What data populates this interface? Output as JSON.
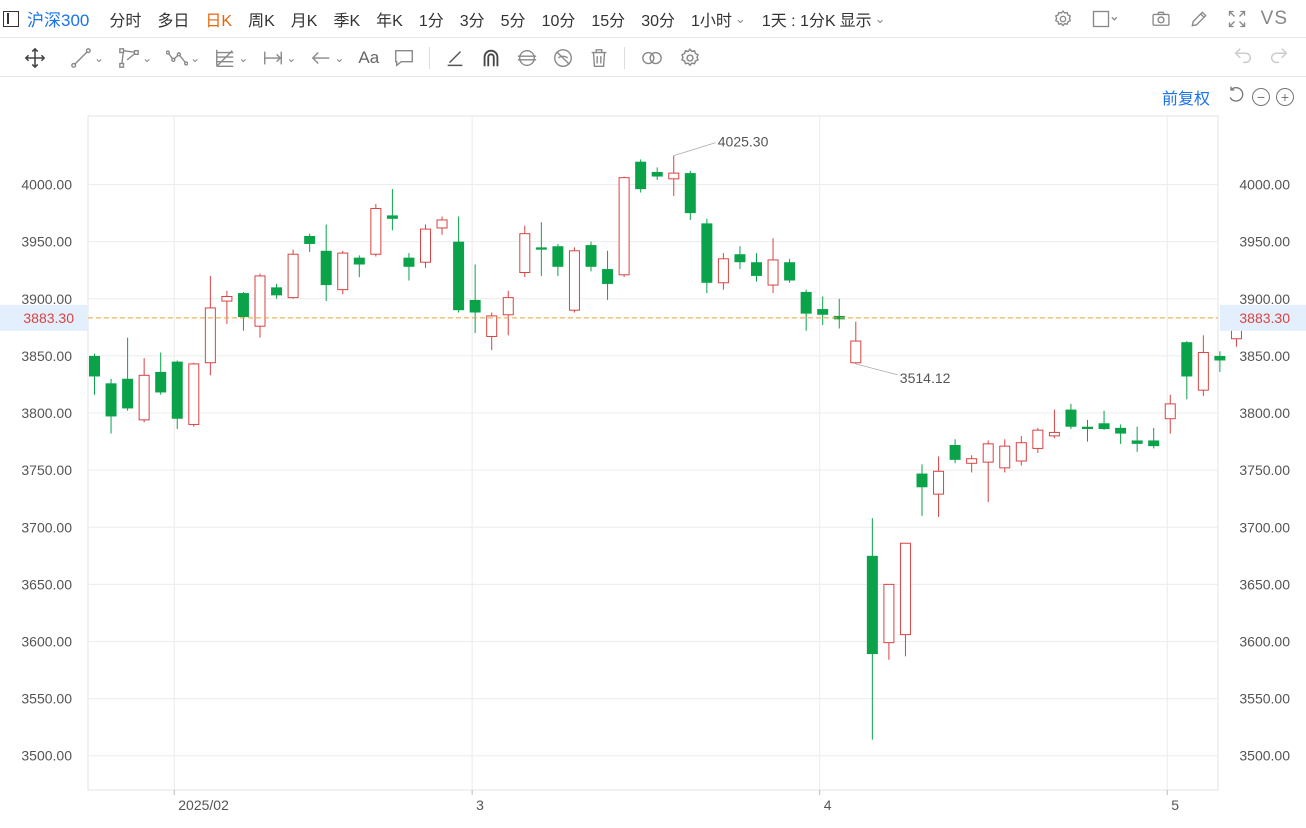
{
  "toolbar": {
    "symbol": "沪深300",
    "periods": [
      "分时",
      "多日",
      "日K",
      "周K",
      "月K",
      "季K",
      "年K",
      "1分",
      "3分",
      "5分",
      "10分",
      "15分",
      "30分"
    ],
    "active_period": "日K",
    "hour_dropdown": "1小时",
    "range_dropdown": "1天 : 1分K",
    "display_dropdown": "显示",
    "vs_label": "VS"
  },
  "drawing_tools": [
    "move",
    "line",
    "polyline",
    "wave",
    "fib",
    "measure",
    "arrow",
    "text",
    "note",
    "brush",
    "arc",
    "magnet",
    "hide",
    "delete",
    "compare",
    "settings"
  ],
  "chart_controls": {
    "adjust_label": "前复权"
  },
  "chart_data": {
    "type": "candlestick",
    "ylim": [
      3470,
      4060
    ],
    "yticks": [
      "3500.00",
      "3550.00",
      "3600.00",
      "3650.00",
      "3700.00",
      "3750.00",
      "3800.00",
      "3850.00",
      "3900.00",
      "3950.00",
      "4000.00"
    ],
    "xticks": [
      {
        "label": "2025/02",
        "index": 5
      },
      {
        "label": "3",
        "index": 23
      },
      {
        "label": "4",
        "index": 44
      },
      {
        "label": "5",
        "index": 65
      }
    ],
    "current_price": "3883.30",
    "current_value": 3883.3,
    "max_label": "4025.30",
    "max_index": 35,
    "min_label": "3514.12",
    "min_index": 46,
    "up_color": "#d94343",
    "down_color": "#0aa34a",
    "candles": [
      {
        "o": 3850,
        "h": 3852,
        "l": 3816,
        "c": 3832
      },
      {
        "o": 3826,
        "h": 3830,
        "l": 3782,
        "c": 3797
      },
      {
        "o": 3830,
        "h": 3866,
        "l": 3802,
        "c": 3804
      },
      {
        "o": 3794,
        "h": 3848,
        "l": 3792,
        "c": 3833
      },
      {
        "o": 3836,
        "h": 3853,
        "l": 3816,
        "c": 3818
      },
      {
        "o": 3845,
        "h": 3846,
        "l": 3786,
        "c": 3795
      },
      {
        "o": 3790,
        "h": 3844,
        "l": 3788,
        "c": 3843
      },
      {
        "o": 3844,
        "h": 3920,
        "l": 3833,
        "c": 3892
      },
      {
        "o": 3898,
        "h": 3907,
        "l": 3878,
        "c": 3902
      },
      {
        "o": 3905,
        "h": 3906,
        "l": 3872,
        "c": 3884
      },
      {
        "o": 3876,
        "h": 3922,
        "l": 3866,
        "c": 3920
      },
      {
        "o": 3910,
        "h": 3913,
        "l": 3900,
        "c": 3903
      },
      {
        "o": 3901,
        "h": 3943,
        "l": 3900,
        "c": 3939
      },
      {
        "o": 3955,
        "h": 3957,
        "l": 3941,
        "c": 3948
      },
      {
        "o": 3942,
        "h": 3965,
        "l": 3898,
        "c": 3912
      },
      {
        "o": 3908,
        "h": 3942,
        "l": 3904,
        "c": 3940
      },
      {
        "o": 3936,
        "h": 3938,
        "l": 3919,
        "c": 3930
      },
      {
        "o": 3939,
        "h": 3983,
        "l": 3937,
        "c": 3979
      },
      {
        "o": 3973,
        "h": 3996,
        "l": 3960,
        "c": 3970
      },
      {
        "o": 3936,
        "h": 3940,
        "l": 3916,
        "c": 3928
      },
      {
        "o": 3932,
        "h": 3965,
        "l": 3927,
        "c": 3961
      },
      {
        "o": 3962,
        "h": 3972,
        "l": 3956,
        "c": 3969
      },
      {
        "o": 3950,
        "h": 3972,
        "l": 3888,
        "c": 3890
      },
      {
        "o": 3899,
        "h": 3930,
        "l": 3870,
        "c": 3888
      },
      {
        "o": 3867,
        "h": 3888,
        "l": 3855,
        "c": 3885
      },
      {
        "o": 3886,
        "h": 3907,
        "l": 3868,
        "c": 3901
      },
      {
        "o": 3923,
        "h": 3964,
        "l": 3919,
        "c": 3957
      },
      {
        "o": 3945,
        "h": 3967,
        "l": 3920,
        "c": 3943
      },
      {
        "o": 3946,
        "h": 3948,
        "l": 3920,
        "c": 3928
      },
      {
        "o": 3890,
        "h": 3945,
        "l": 3888,
        "c": 3942
      },
      {
        "o": 3947,
        "h": 3950,
        "l": 3924,
        "c": 3928
      },
      {
        "o": 3926,
        "h": 3942,
        "l": 3899,
        "c": 3913
      },
      {
        "o": 3921,
        "h": 4007,
        "l": 3919,
        "c": 4006
      },
      {
        "o": 4020,
        "h": 4022,
        "l": 3993,
        "c": 3996
      },
      {
        "o": 4011,
        "h": 4015,
        "l": 4004,
        "c": 4007
      },
      {
        "o": 4005,
        "h": 4025.3,
        "l": 3990,
        "c": 4010
      },
      {
        "o": 4010,
        "h": 4012,
        "l": 3969,
        "c": 3975
      },
      {
        "o": 3966,
        "h": 3970,
        "l": 3905,
        "c": 3914
      },
      {
        "o": 3914,
        "h": 3940,
        "l": 3908,
        "c": 3935
      },
      {
        "o": 3939,
        "h": 3946,
        "l": 3926,
        "c": 3932
      },
      {
        "o": 3932,
        "h": 3940,
        "l": 3915,
        "c": 3920
      },
      {
        "o": 3912,
        "h": 3953,
        "l": 3905,
        "c": 3934
      },
      {
        "o": 3932,
        "h": 3935,
        "l": 3914,
        "c": 3916
      },
      {
        "o": 3906,
        "h": 3908,
        "l": 3872,
        "c": 3887
      },
      {
        "o": 3891,
        "h": 3902,
        "l": 3877,
        "c": 3886
      },
      {
        "o": 3885,
        "h": 3900,
        "l": 3874,
        "c": 3882
      },
      {
        "o": 3844,
        "h": 3880,
        "l": 3843,
        "c": 3863
      },
      {
        "o": 3675,
        "h": 3708,
        "l": 3514.12,
        "c": 3589
      },
      {
        "o": 3599,
        "h": 3650,
        "l": 3584,
        "c": 3650
      },
      {
        "o": 3606,
        "h": 3686,
        "l": 3587,
        "c": 3686
      },
      {
        "o": 3747,
        "h": 3755,
        "l": 3710,
        "c": 3735
      },
      {
        "o": 3729,
        "h": 3762,
        "l": 3709,
        "c": 3749
      },
      {
        "o": 3772,
        "h": 3777,
        "l": 3756,
        "c": 3759
      },
      {
        "o": 3756,
        "h": 3763,
        "l": 3748,
        "c": 3760
      },
      {
        "o": 3757,
        "h": 3776,
        "l": 3722,
        "c": 3773
      },
      {
        "o": 3752,
        "h": 3777,
        "l": 3748,
        "c": 3771
      },
      {
        "o": 3758,
        "h": 3780,
        "l": 3754,
        "c": 3774
      },
      {
        "o": 3769,
        "h": 3787,
        "l": 3765,
        "c": 3785
      },
      {
        "o": 3780,
        "h": 3803,
        "l": 3778,
        "c": 3783
      },
      {
        "o": 3803,
        "h": 3808,
        "l": 3786,
        "c": 3788
      },
      {
        "o": 3788,
        "h": 3794,
        "l": 3775,
        "c": 3786
      },
      {
        "o": 3791,
        "h": 3802,
        "l": 3785,
        "c": 3786
      },
      {
        "o": 3787,
        "h": 3790,
        "l": 3773,
        "c": 3782
      },
      {
        "o": 3776,
        "h": 3788,
        "l": 3766,
        "c": 3773
      },
      {
        "o": 3776,
        "h": 3787,
        "l": 3769,
        "c": 3771
      },
      {
        "o": 3795,
        "h": 3816,
        "l": 3782,
        "c": 3808
      },
      {
        "o": 3862,
        "h": 3863,
        "l": 3812,
        "c": 3832
      },
      {
        "o": 3820,
        "h": 3868,
        "l": 3815,
        "c": 3853
      },
      {
        "o": 3850,
        "h": 3854,
        "l": 3836,
        "c": 3846
      },
      {
        "o": 3865,
        "h": 3891,
        "l": 3858,
        "c": 3883.3
      }
    ]
  }
}
